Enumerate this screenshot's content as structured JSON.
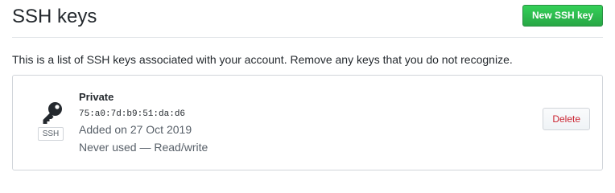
{
  "header": {
    "title": "SSH keys",
    "new_key_button": "New SSH key"
  },
  "intro_text": "This is a list of SSH keys associated with your account. Remove any keys that you do not recognize.",
  "keys": [
    {
      "icon": "key-icon",
      "type_label": "SSH",
      "title": "Private",
      "fingerprint": "75:a0:7d:b9:51:da:d6",
      "added": "Added on 27 Oct 2019",
      "usage": "Never used — Read/write",
      "delete_label": "Delete"
    }
  ],
  "colors": {
    "primary_button": "#2cbe4e",
    "danger_text": "#cb2431"
  }
}
